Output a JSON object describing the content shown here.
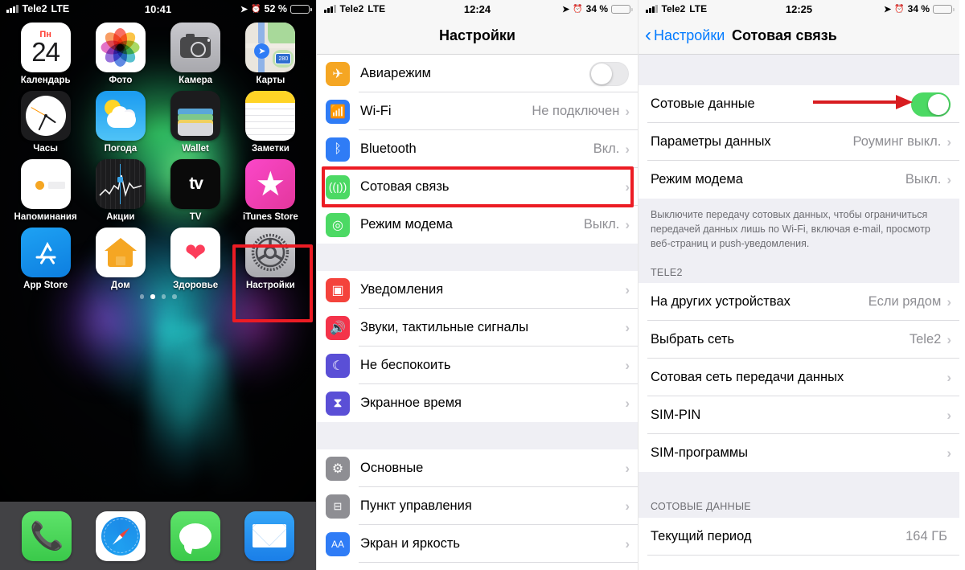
{
  "home": {
    "status": {
      "carrier": "Tele2",
      "network": "LTE",
      "time": "10:41",
      "battery": "52 %",
      "battery_pct": 52
    },
    "apps": [
      {
        "name": "Календарь",
        "icon": "calendar-icon",
        "day_name": "Пн",
        "day_num": "24"
      },
      {
        "name": "Фото",
        "icon": "photos-icon"
      },
      {
        "name": "Камера",
        "icon": "camera-icon"
      },
      {
        "name": "Карты",
        "icon": "maps-icon",
        "badge": "280"
      },
      {
        "name": "Часы",
        "icon": "clock-icon"
      },
      {
        "name": "Погода",
        "icon": "weather-icon"
      },
      {
        "name": "Wallet",
        "icon": "wallet-icon"
      },
      {
        "name": "Заметки",
        "icon": "notes-icon"
      },
      {
        "name": "Напоминания",
        "icon": "reminders-icon"
      },
      {
        "name": "Акции",
        "icon": "stocks-icon"
      },
      {
        "name": "TV",
        "icon": "tv-icon",
        "glyph": "tv"
      },
      {
        "name": "iTunes Store",
        "icon": "itunes-store-icon"
      },
      {
        "name": "App Store",
        "icon": "app-store-icon"
      },
      {
        "name": "Дом",
        "icon": "home-app-icon"
      },
      {
        "name": "Здоровье",
        "icon": "health-icon"
      },
      {
        "name": "Настройки",
        "icon": "settings-gear-icon",
        "highlighted": true
      }
    ],
    "page_dots": {
      "count": 4,
      "active_index": 1
    },
    "dock": [
      {
        "name": "Телефон",
        "icon": "phone-icon"
      },
      {
        "name": "Safari",
        "icon": "safari-compass-icon"
      },
      {
        "name": "Сообщения",
        "icon": "messages-icon"
      },
      {
        "name": "Почта",
        "icon": "mail-icon"
      }
    ],
    "highlight_color": "#ec1c24"
  },
  "settings": {
    "status": {
      "carrier": "Tele2",
      "network": "LTE",
      "time": "12:24",
      "battery": "34 %",
      "battery_pct": 34
    },
    "title": "Настройки",
    "group1": [
      {
        "label": "Авиарежим",
        "icon": "airplane-icon",
        "icon_color": "#f5a623",
        "control": "toggle",
        "toggle_on": false
      },
      {
        "label": "Wi-Fi",
        "icon": "wifi-icon",
        "icon_color": "#2f7cf6",
        "value": "Не подключен",
        "control": "chevron"
      },
      {
        "label": "Bluetooth",
        "icon": "bluetooth-icon",
        "icon_color": "#2f7cf6",
        "value": "Вкл.",
        "control": "chevron"
      },
      {
        "label": "Сотовая связь",
        "icon": "cellular-antenna-icon",
        "icon_color": "#4cd964",
        "value": "",
        "control": "chevron",
        "highlighted": true
      },
      {
        "label": "Режим модема",
        "icon": "hotspot-icon",
        "icon_color": "#4cd964",
        "value": "Выкл.",
        "control": "chevron"
      }
    ],
    "group2": [
      {
        "label": "Уведомления",
        "icon": "notifications-icon",
        "icon_color": "#f4433c",
        "control": "chevron"
      },
      {
        "label": "Звуки, тактильные сигналы",
        "icon": "sounds-icon",
        "icon_color": "#f4334a",
        "control": "chevron"
      },
      {
        "label": "Не беспокоить",
        "icon": "moon-icon",
        "icon_color": "#5a4fd6",
        "control": "chevron"
      },
      {
        "label": "Экранное время",
        "icon": "hourglass-icon",
        "icon_color": "#5a4fd6",
        "control": "chevron"
      }
    ],
    "group3": [
      {
        "label": "Основные",
        "icon": "gear-icon",
        "icon_color": "#8e8e93",
        "control": "chevron"
      },
      {
        "label": "Пункт управления",
        "icon": "control-center-icon",
        "icon_color": "#8e8e93",
        "control": "chevron"
      },
      {
        "label": "Экран и яркость",
        "icon": "display-brightness-icon",
        "icon_color": "#2f7cf6",
        "control": "chevron"
      }
    ]
  },
  "cellular": {
    "status": {
      "carrier": "Tele2",
      "network": "LTE",
      "time": "12:25",
      "battery": "34 %",
      "battery_pct": 34
    },
    "back_label": "Настройки",
    "title": "Сотовая связь",
    "group1": [
      {
        "label": "Сотовые данные",
        "control": "toggle",
        "toggle_on": true,
        "annotated_arrow": true
      },
      {
        "label": "Параметры данных",
        "value": "Роуминг выкл.",
        "control": "chevron"
      },
      {
        "label": "Режим модема",
        "value": "Выкл.",
        "control": "chevron"
      }
    ],
    "note": "Выключите передачу сотовых данных, чтобы ограничиться передачей данных лишь по Wi-Fi, включая e-mail, просмотр веб-страниц и push-уведомления.",
    "section_header": "TELE2",
    "group2": [
      {
        "label": "На других устройствах",
        "value": "Если рядом",
        "control": "chevron"
      },
      {
        "label": "Выбрать сеть",
        "value": "Tele2",
        "control": "chevron"
      },
      {
        "label": "Сотовая сеть передачи данных",
        "value": "",
        "control": "chevron"
      },
      {
        "label": "SIM-PIN",
        "value": "",
        "control": "chevron"
      },
      {
        "label": "SIM-программы",
        "value": "",
        "control": "chevron"
      }
    ],
    "section_header2": "СОТОВЫЕ ДАННЫЕ",
    "group3": [
      {
        "label": "Текущий период",
        "value": "164 ГБ",
        "control": "none"
      }
    ],
    "arrow_color": "#d81c20"
  }
}
